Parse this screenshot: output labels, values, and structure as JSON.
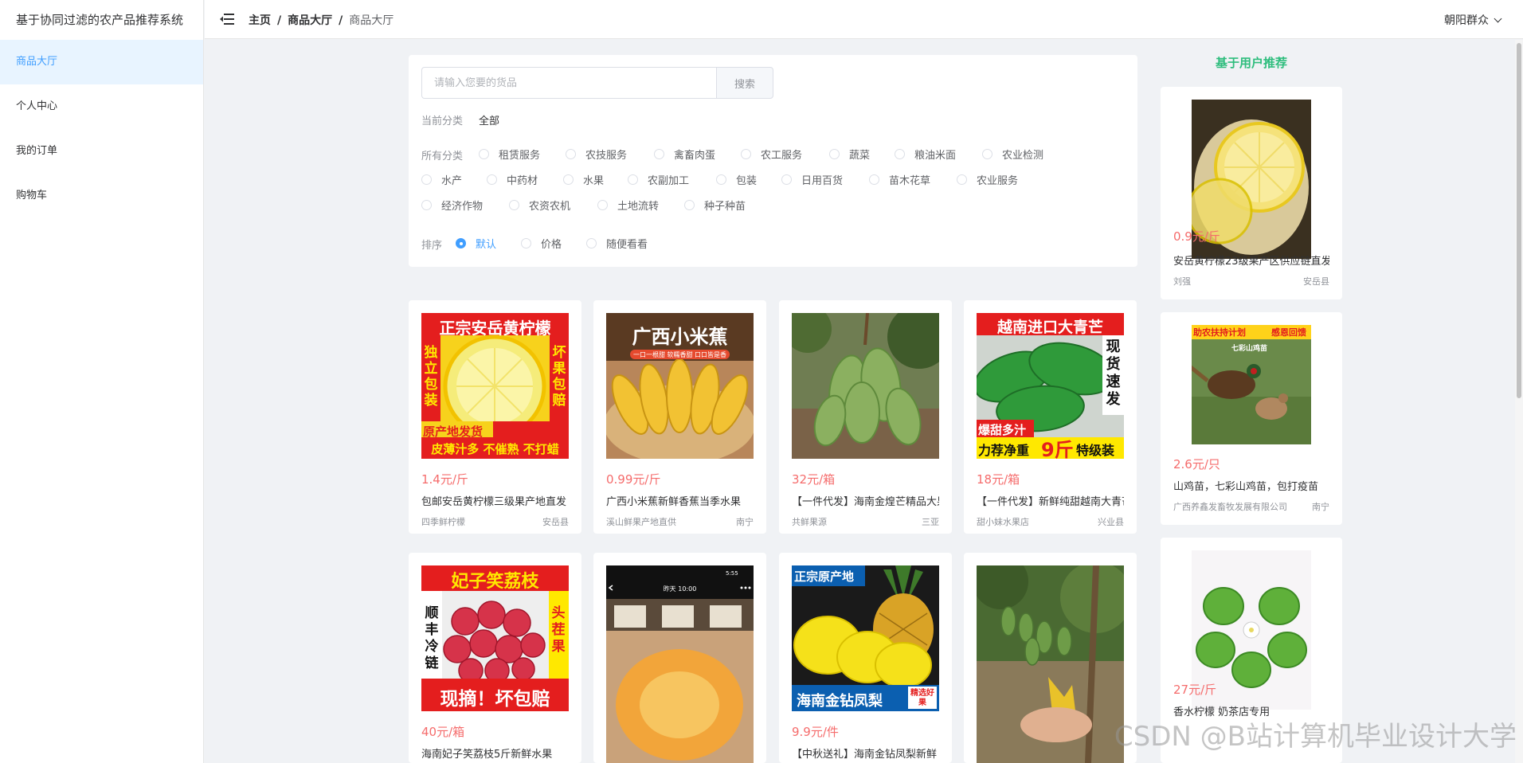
{
  "system_title": "基于协同过滤的农产品推荐系统",
  "sidebar": {
    "items": [
      {
        "label": "商品大厅"
      },
      {
        "label": "个人中心"
      },
      {
        "label": "我的订单"
      },
      {
        "label": "购物车"
      }
    ]
  },
  "header": {
    "breadcrumb": [
      "主页",
      "商品大厅",
      "商品大厅"
    ],
    "user_name": "朝阳群众"
  },
  "filter": {
    "search_placeholder": "请输入您要的货品",
    "search_button": "搜索",
    "current_label": "当前分类",
    "current_value": "全部",
    "all_label": "所有分类",
    "categories": [
      "租赁服务",
      "农技服务",
      "禽畜肉蛋",
      "农工服务",
      "蔬菜",
      "粮油米面",
      "农业检测",
      "水产",
      "中药材",
      "水果",
      "农副加工",
      "包装",
      "日用百货",
      "苗木花草",
      "农业服务",
      "经济作物",
      "农资农机",
      "土地流转",
      "种子种苗"
    ],
    "sort_label": "排序",
    "sort_options": [
      "默认",
      "价格",
      "随便看看"
    ],
    "sort_selected": "默认"
  },
  "products": [
    {
      "price": "1.4元/斤",
      "name": "包邮安岳黄柠檬三级果产地直发",
      "shop": "四季鲜柠檬",
      "area": "安岳县",
      "banner_top": "正宗安岳黄柠檬",
      "banner_left": "独立包装",
      "banner_right": "坏果包赔",
      "banner_b1": "原产地发货",
      "banner_b2": "皮薄汁多 不催熟 不打蜡"
    },
    {
      "price": "0.99元/斤",
      "name": "广西小米蕉新鲜香蕉当季水果",
      "shop": "溪山鲜果产地直供",
      "area": "南宁",
      "banner_top": "广西小米蕉",
      "banner_sub": "一口一根甜 软糯香甜 口口皆是香"
    },
    {
      "price": "32元/箱",
      "name": "【一件代发】海南金煌芒精品大果",
      "shop": "共鲜果源",
      "area": "三亚"
    },
    {
      "price": "18元/箱",
      "name": "【一件代发】新鲜纯甜越南大青芒",
      "shop": "甜小妹水果店",
      "area": "兴业县",
      "banner_top": "越南进口大青芒",
      "banner_right": "现货速发",
      "banner_b0": "爆甜多汁",
      "banner_b1": "力荐净重",
      "banner_b2": "9斤",
      "banner_b3": "特级装"
    },
    {
      "price": "40元/箱",
      "name": "海南妃子笑荔枝5斤新鲜水果",
      "banner_top": "妃子笑荔枝",
      "banner_left": "顺丰冷链",
      "banner_right": "头茬果",
      "banner_b1": "现摘！坏包赔"
    },
    {
      "price": "",
      "name": "",
      "status_time": "昨天 10:00",
      "status_clock": "5:55"
    },
    {
      "price": "9.9元/件",
      "name": "【中秋送礼】海南金钻凤梨新鲜",
      "banner_top": "正宗原产地",
      "banner_b1": "海南金钻凤梨",
      "banner_badge": "精选好果"
    },
    {
      "price": "",
      "name": ""
    }
  ],
  "recommend": {
    "title": "基于用户推荐",
    "items": [
      {
        "price": "0.9元/斤",
        "name": "安岳黄柠檬23级果产区供应链直发",
        "shop": "刘强",
        "area": "安岳县"
      },
      {
        "price": "2.6元/只",
        "name": "山鸡苗，七彩山鸡苗，包打疫苗",
        "shop": "广西养鑫发畜牧发展有限公司",
        "area": "南宁",
        "banner_l": "助农扶持计划",
        "banner_r": "感恩回馈",
        "banner_sub": "七彩山鸡苗"
      },
      {
        "price": "27元/斤",
        "name": "香水柠檬 奶茶店专用",
        "shop": "",
        "area": ""
      }
    ]
  },
  "watermark": "CSDN @B站计算机毕业设计大学"
}
